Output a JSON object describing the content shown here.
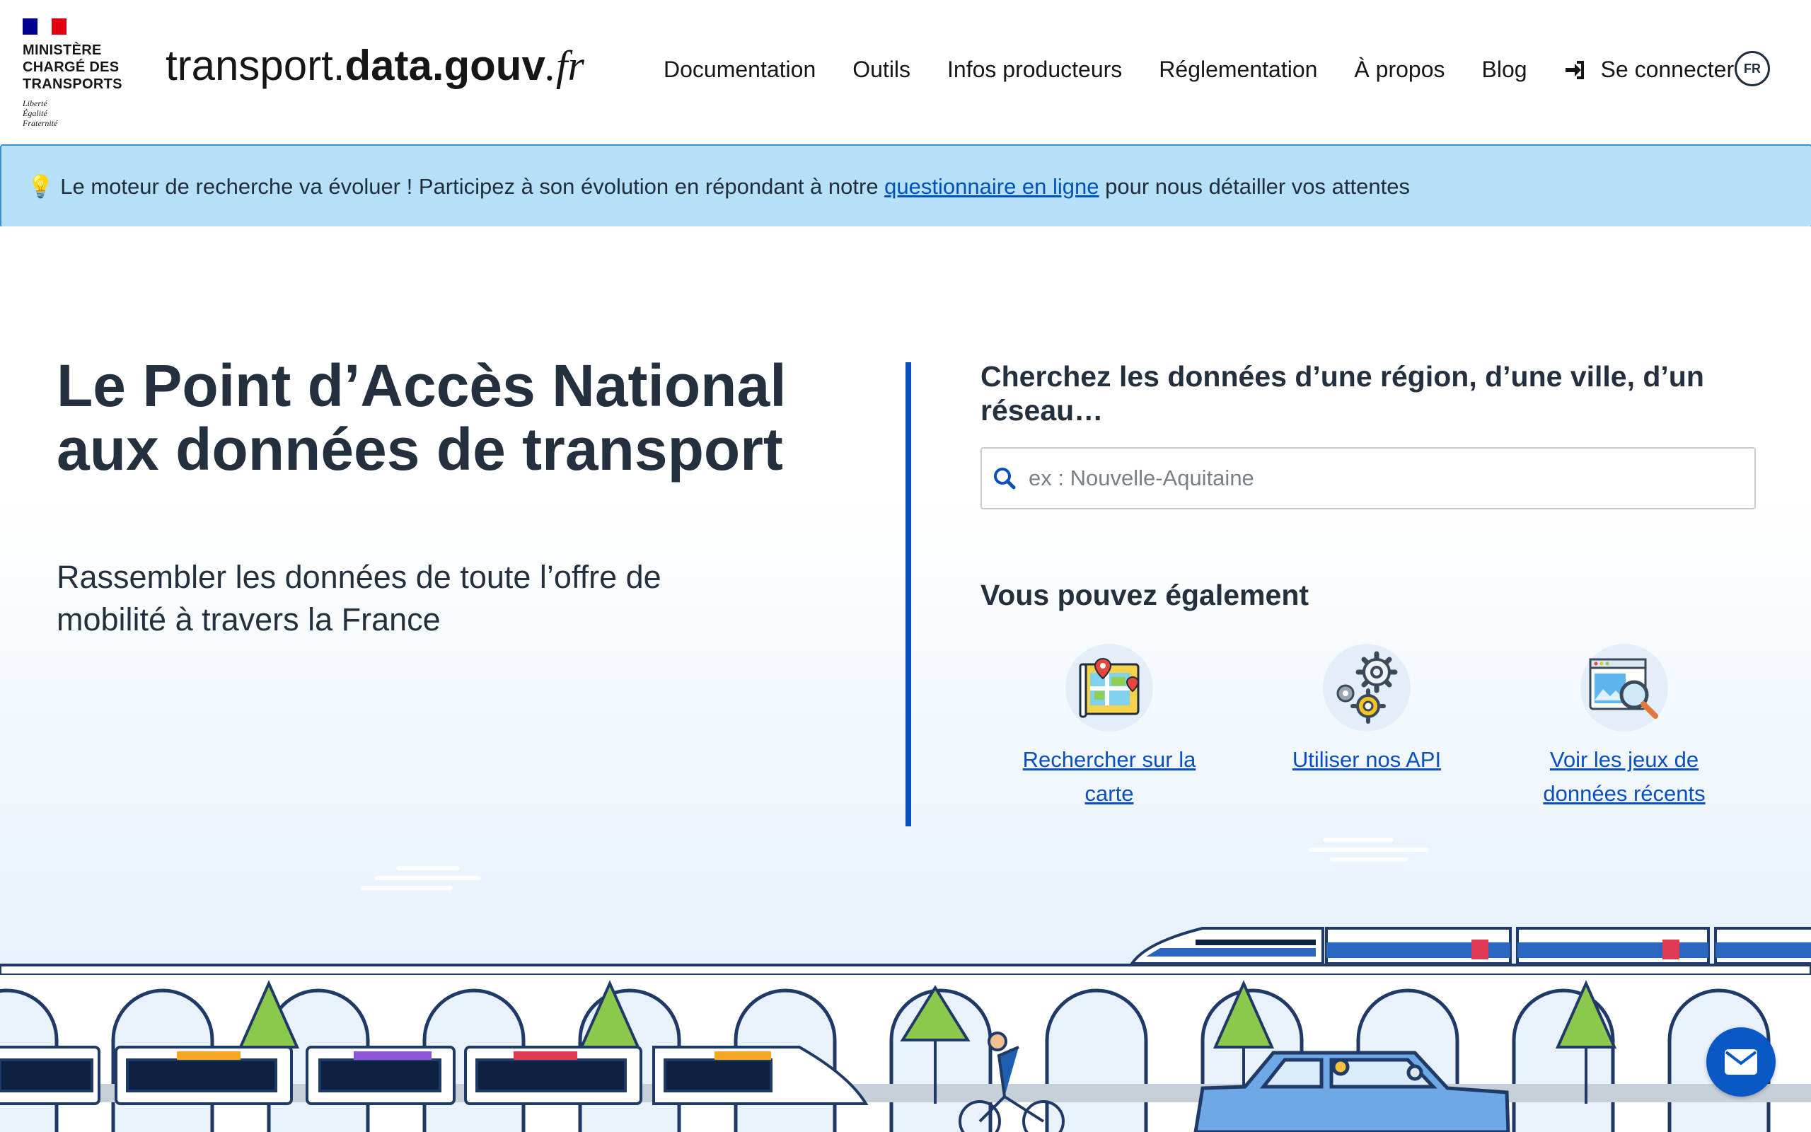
{
  "header": {
    "ministry_lines": "MINISTÈRE\nCHARGÉ DES\nTRANSPORTS",
    "motto": "Liberté\nÉgalité\nFraternité",
    "site_title_part1": "transport.",
    "site_title_part2": "data.gouv",
    "site_title_part3": ".fr",
    "nav": [
      "Documentation",
      "Outils",
      "Infos producteurs",
      "Réglementation",
      "À propos",
      "Blog"
    ],
    "login_label": "Se connecter",
    "language": "FR"
  },
  "banner": {
    "emoji": "💡",
    "text_before": "Le moteur de recherche va évoluer ! Participez à son évolution en répondant à notre ",
    "link_text": "questionnaire en ligne",
    "text_after": " pour nous détailler vos attentes"
  },
  "hero": {
    "title": "Le Point d’Accès National aux données de transport",
    "subtitle": "Rassembler les données de toute l’offre de mobilité à travers la France"
  },
  "search": {
    "title": "Cherchez les données d’une région, d’une ville, d’un réseau…",
    "placeholder": "ex : Nouvelle-Aquitaine"
  },
  "also": {
    "title": "Vous pouvez également",
    "actions": [
      {
        "label": "Rechercher sur la carte",
        "icon": "map-icon"
      },
      {
        "label": "Utiliser nos API",
        "icon": "gears-icon"
      },
      {
        "label": "Voir les jeux de données récents",
        "icon": "dataset-search-icon"
      }
    ]
  },
  "colors": {
    "accent": "#0a4fbf",
    "banner_bg": "#b6e0f8",
    "text": "#24303e"
  }
}
